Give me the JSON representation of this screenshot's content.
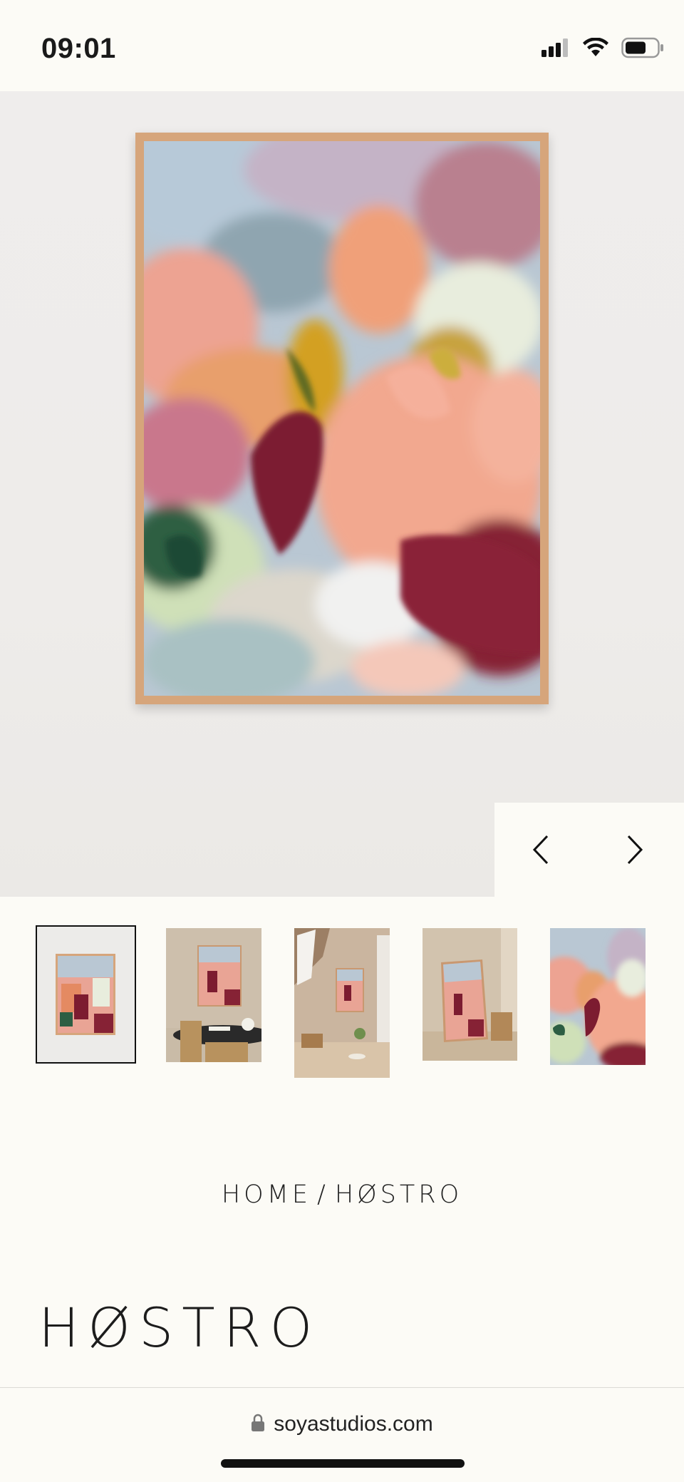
{
  "status_bar": {
    "time": "09:01",
    "icons": [
      "cellular-signal-icon",
      "wifi-icon",
      "battery-icon"
    ]
  },
  "hero": {
    "image_alt": "framed-abstract-painting-on-wall",
    "nav_prev_icon": "chevron-left-icon",
    "nav_next_icon": "chevron-right-icon"
  },
  "thumbnails": [
    {
      "name": "thumb-framed-print",
      "selected": true
    },
    {
      "name": "thumb-dining-room",
      "selected": false
    },
    {
      "name": "thumb-table-room",
      "selected": false
    },
    {
      "name": "thumb-leaning-frame",
      "selected": false
    },
    {
      "name": "thumb-closeup",
      "selected": false
    }
  ],
  "breadcrumb": {
    "home": "HOME",
    "separator": "/",
    "current": "HØSTRO"
  },
  "product": {
    "title": "HØSTRO"
  },
  "browser": {
    "url": "soyastudios.com",
    "lock_icon": "lock-icon"
  },
  "colors": {
    "background": "#fcfbf6",
    "frame_wood": "#d6a57b",
    "wall": "#eeecea",
    "text": "#1a1a1a"
  }
}
